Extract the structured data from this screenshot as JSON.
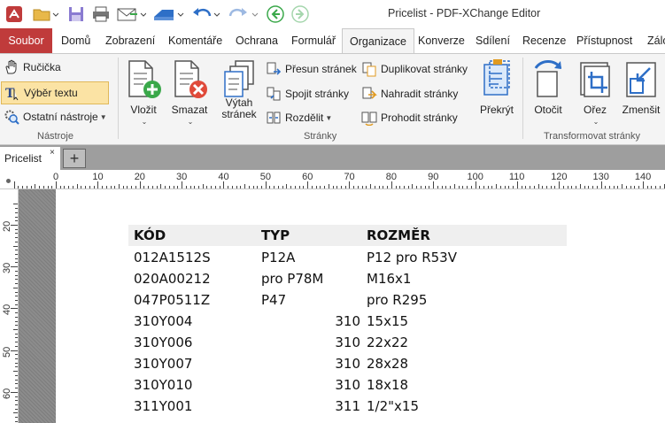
{
  "app": {
    "title": "Pricelist - PDF-XChange Editor"
  },
  "menu_tabs": [
    "Soubor",
    "Domů",
    "Zobrazení",
    "Komentáře",
    "Ochrana",
    "Formulář",
    "Organizace",
    "Konverze",
    "Sdílení",
    "Recenze",
    "Přístupnost",
    "Zálo"
  ],
  "active_tab": "Organizace",
  "ribbon": {
    "tools": {
      "hand": "Ručička",
      "select_text": "Výběr textu",
      "other_tools": "Ostatní nástroje",
      "group_label": "Nástroje"
    },
    "pages": {
      "insert": "Vložit",
      "delete": "Smazat",
      "extract_line1": "Výtah",
      "extract_line2": "stránek",
      "move": "Přesun stránek",
      "merge": "Spojit stránky",
      "split": "Rozdělit",
      "duplicate": "Duplikovat stránky",
      "replace": "Nahradit stránky",
      "swap": "Prohodit stránky",
      "overlay": "Překrýt",
      "group_label": "Stránky"
    },
    "transform": {
      "rotate": "Otočit",
      "crop": "Ořez",
      "shrink": "Zmenšit",
      "group_label": "Transformovat stránky"
    }
  },
  "document_tab": {
    "name": "Pricelist",
    "close": "×",
    "new_tab": "+"
  },
  "ruler": {
    "h_labels": [
      "0",
      "10",
      "20",
      "30",
      "40",
      "50",
      "60",
      "70",
      "80",
      "90",
      "100",
      "110",
      "120",
      "130",
      "140"
    ],
    "v_labels": [
      "20",
      "30",
      "40",
      "50",
      "60"
    ]
  },
  "table": {
    "headers": [
      "KÓD",
      "TYP",
      "ROZMĚR"
    ],
    "rows": [
      {
        "code": "012A1512S",
        "type": "P12A",
        "num": "",
        "size": "P12 pro R53V"
      },
      {
        "code": "020A00212",
        "type": "pro P78M",
        "num": "",
        "size": "M16x1"
      },
      {
        "code": "047P0511Z",
        "type": "P47",
        "num": "",
        "size": "pro R295"
      },
      {
        "code": "310Y004",
        "type": "",
        "num": "310",
        "size": "15x15"
      },
      {
        "code": "310Y006",
        "type": "",
        "num": "310",
        "size": "22x22"
      },
      {
        "code": "310Y007",
        "type": "",
        "num": "310",
        "size": "28x28"
      },
      {
        "code": "310Y010",
        "type": "",
        "num": "310",
        "size": "18x18"
      },
      {
        "code": "311Y001",
        "type": "",
        "num": "311",
        "size": "1/2\"x15"
      }
    ]
  },
  "colors": {
    "file_tab": "#c03b3b",
    "accent_blue": "#2e6fc7",
    "green": "#3aa84a",
    "red": "#e04a3a"
  }
}
